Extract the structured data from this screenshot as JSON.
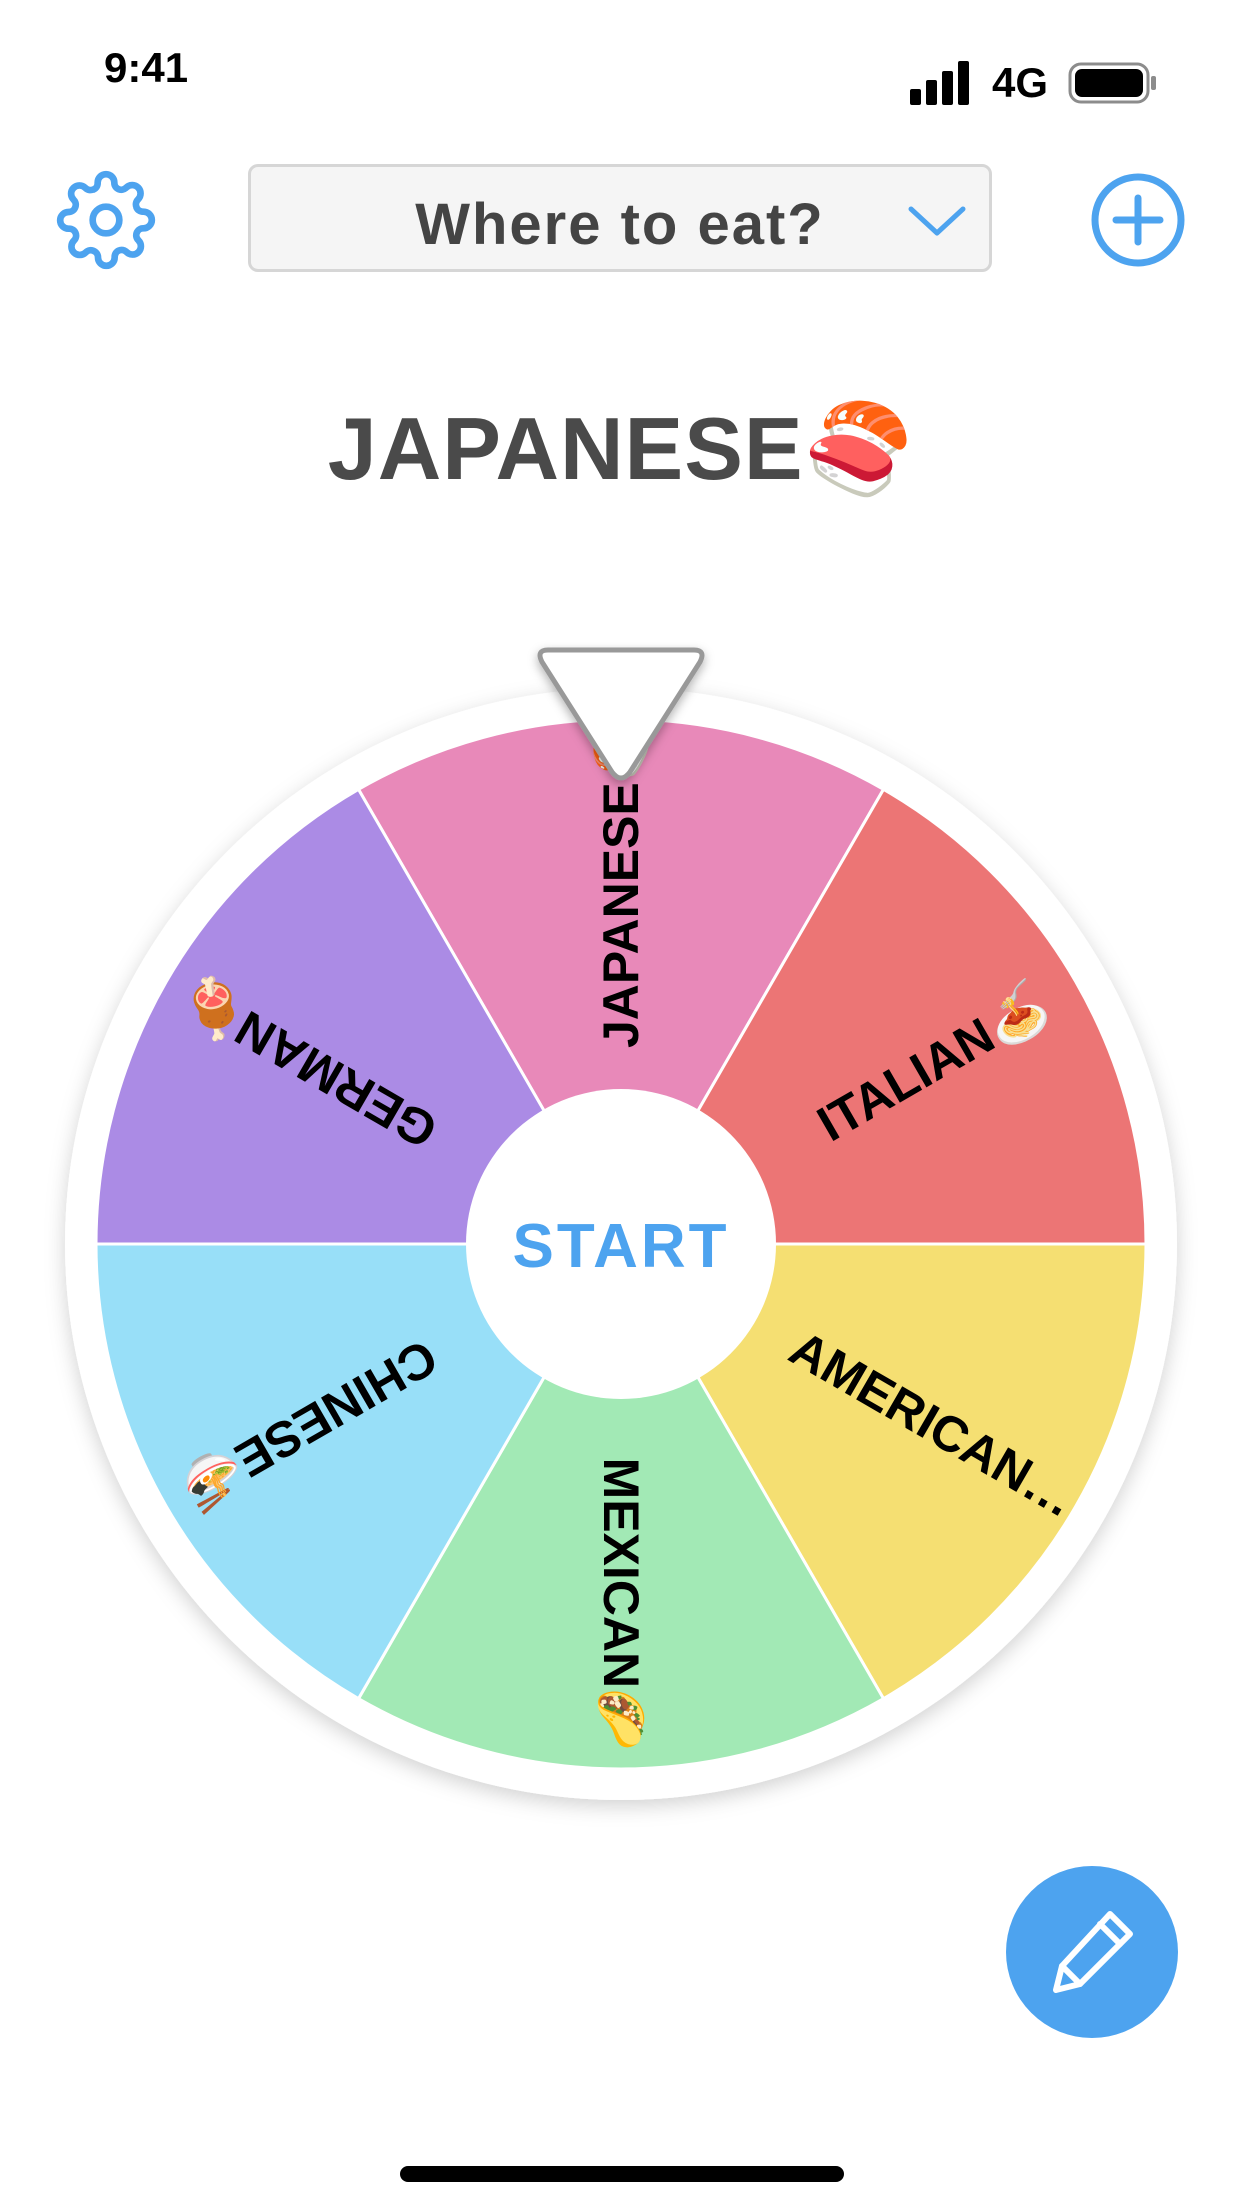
{
  "status_bar": {
    "time": "9:41",
    "network": "4G",
    "signal_icon": "signal-bars-icon",
    "battery_icon": "battery-full-icon"
  },
  "toolbar": {
    "settings_icon": "gear-icon",
    "wheel_title": "Where to eat?",
    "dropdown_icon": "chevron-down-icon",
    "add_icon": "plus-circle-icon"
  },
  "result": {
    "text": "JAPANESE🍣"
  },
  "wheel": {
    "segments": [
      {
        "label": "JAPANESE🍣",
        "color": "#e889b9"
      },
      {
        "label": "ITALIAN🍝",
        "color": "#ec7575"
      },
      {
        "label": "AMERICAN…",
        "color": "#f5df72"
      },
      {
        "label": "MEXICAN🌮",
        "color": "#a2e9b5"
      },
      {
        "label": "CHINESE🍜",
        "color": "#98dff8"
      },
      {
        "label": "GERMAN🍖",
        "color": "#ab8be5"
      }
    ],
    "start_label": "START"
  },
  "fab": {
    "icon": "pencil-icon"
  },
  "colors": {
    "accent": "#4da3ef",
    "text_dark": "#4a4a4a",
    "select_bg": "#f5f5f5"
  }
}
